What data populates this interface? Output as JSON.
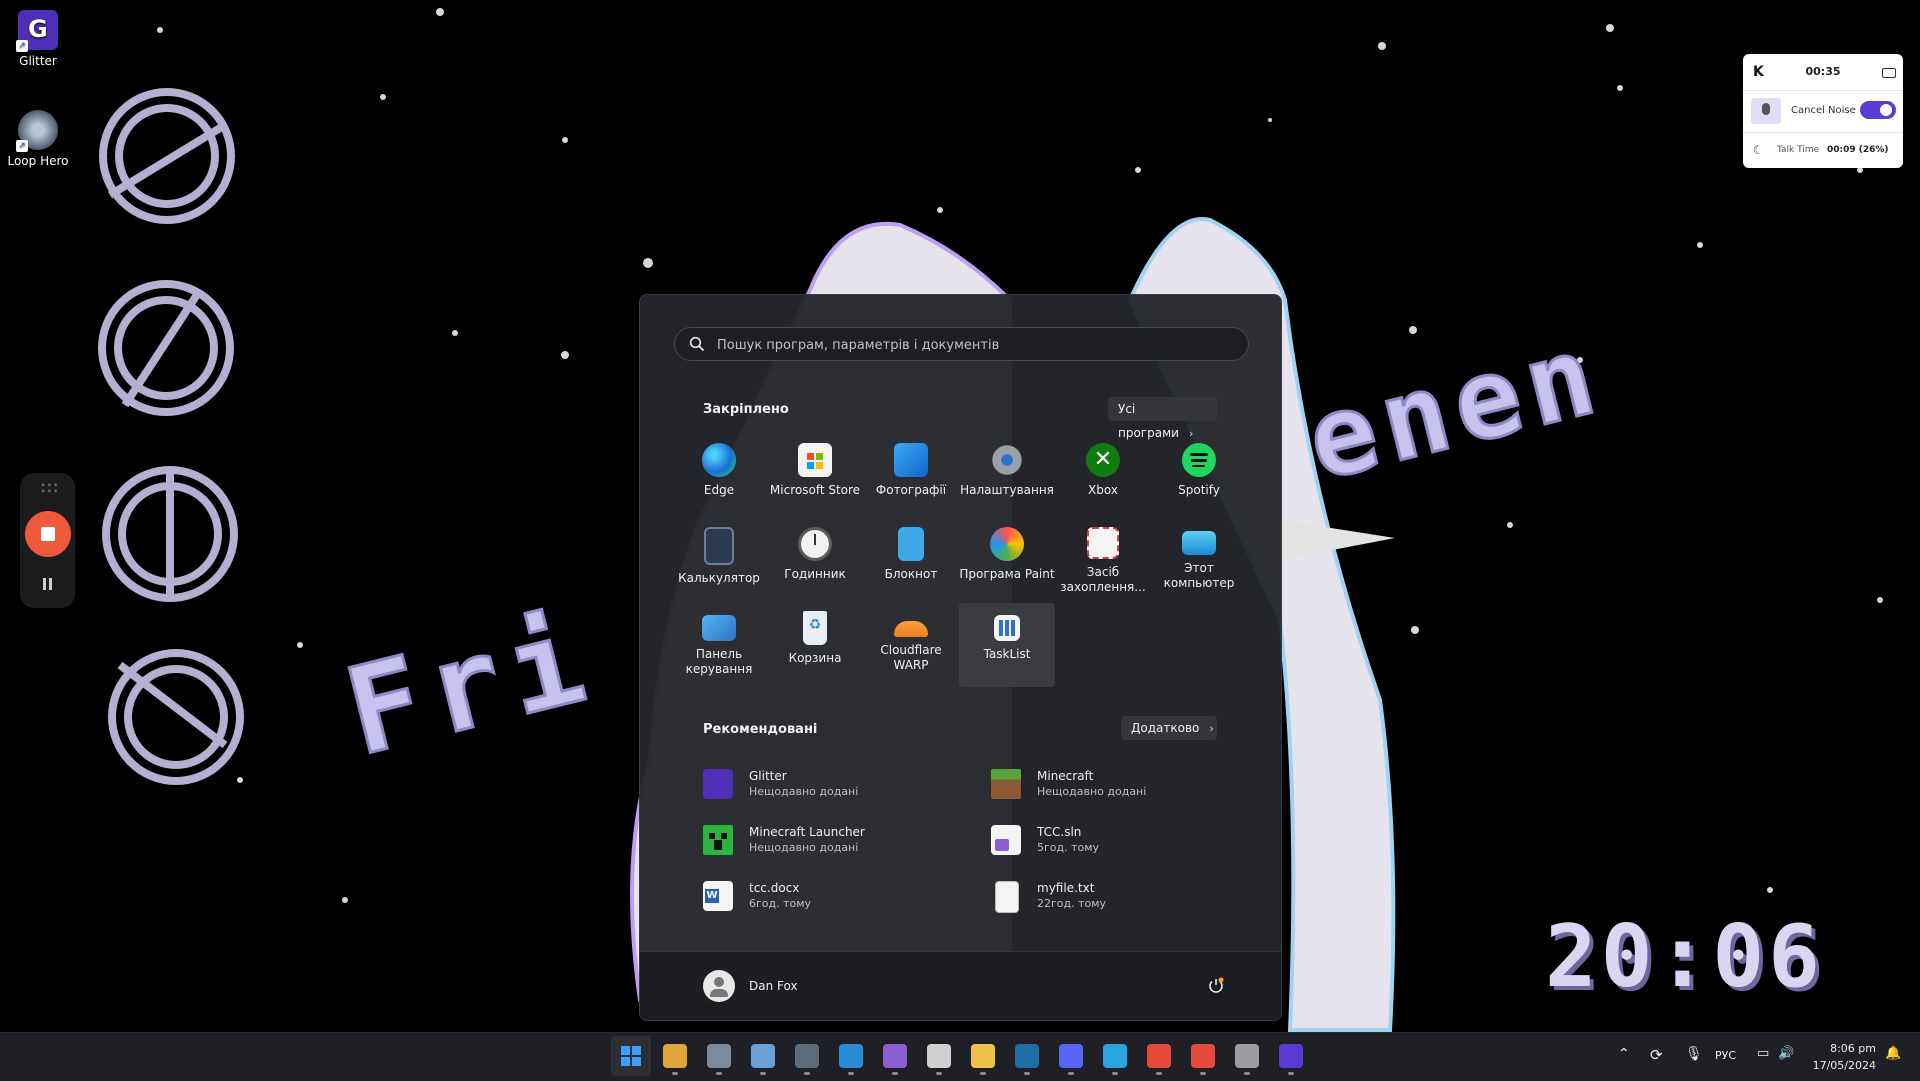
{
  "desktop": {
    "icons": [
      {
        "label": "Glitter",
        "icon": "glitter-app-icon"
      },
      {
        "label": "Loop Hero",
        "icon": "loop-hero-icon"
      }
    ],
    "wallpaper_text": "Fri... ...enen",
    "wallpaper_clock": "20:06"
  },
  "recorder": {
    "grip": "grip-icon",
    "stop": "stop-record-icon",
    "pause": "pause-icon"
  },
  "call_widget": {
    "timer": "00:35",
    "noise_label": "Cancel Noise",
    "noise_enabled": true,
    "talk_label": "Talk Time",
    "talk_value": "00:09 (26%)",
    "accent": "#5b3bd6"
  },
  "start_menu": {
    "search_placeholder": "Пошук програм, параметрів і документів",
    "pinned_title": "Закріплено",
    "all_apps_label": "Усі програми",
    "pinned": [
      {
        "label": "Edge",
        "icon": "edge-icon"
      },
      {
        "label": "Microsoft Store",
        "icon": "store-icon"
      },
      {
        "label": "Фотографії",
        "icon": "photos-icon"
      },
      {
        "label": "Налаштування",
        "icon": "settings-icon"
      },
      {
        "label": "Xbox",
        "icon": "xbox-icon"
      },
      {
        "label": "Spotify",
        "icon": "spotify-icon"
      },
      {
        "label": "Калькулятор",
        "icon": "calculator-icon"
      },
      {
        "label": "Годинник",
        "icon": "clock-icon"
      },
      {
        "label": "Блокнот",
        "icon": "notepad-icon"
      },
      {
        "label": "Програма Paint",
        "icon": "paint-icon"
      },
      {
        "label": "Засіб захоплення...",
        "icon": "snipping-tool-icon"
      },
      {
        "label": "Этот компьютер",
        "icon": "this-pc-icon"
      },
      {
        "label": "Панель керування",
        "icon": "control-panel-icon"
      },
      {
        "label": "Корзина",
        "icon": "recycle-bin-icon"
      },
      {
        "label": "Cloudflare WARP",
        "icon": "cloudflare-icon"
      },
      {
        "label": "TaskList",
        "icon": "tasklist-icon"
      }
    ],
    "recommended_title": "Рекомендовані",
    "more_label": "Додатково",
    "recommended": [
      {
        "name": "Glitter",
        "sub": "Нещодавно додані",
        "icon": "glitter-app-icon"
      },
      {
        "name": "Minecraft",
        "sub": "Нещодавно додані",
        "icon": "minecraft-icon"
      },
      {
        "name": "Minecraft Launcher",
        "sub": "Нещодавно додані",
        "icon": "minecraft-launcher-icon"
      },
      {
        "name": "TCC.sln",
        "sub": "5год. тому",
        "icon": "visual-studio-solution-icon"
      },
      {
        "name": "tcc.docx",
        "sub": "6год. тому",
        "icon": "word-document-icon"
      },
      {
        "name": "myfile.txt",
        "sub": "22год. тому",
        "icon": "text-file-icon"
      }
    ],
    "user_name": "Dan Fox"
  },
  "taskbar": {
    "apps": [
      {
        "name": "start",
        "icon": "windows-start-icon",
        "color": "#3aa0ff"
      },
      {
        "name": "copilot",
        "icon": "copilot-pre-icon",
        "color": "#e0a63b"
      },
      {
        "name": "loop-hero",
        "icon": "loop-hero-icon",
        "color": "#7d8a9a"
      },
      {
        "name": "paint-net",
        "icon": "image-editor-icon",
        "color": "#6aa0d8"
      },
      {
        "name": "calculator",
        "icon": "calculator-icon",
        "color": "#5d6b7a"
      },
      {
        "name": "vscode",
        "icon": "vscode-icon",
        "color": "#2a8bd8"
      },
      {
        "name": "visual-studio",
        "icon": "visual-studio-icon",
        "color": "#8a5fd0"
      },
      {
        "name": "unity",
        "icon": "unity-icon",
        "color": "#cfcfcf"
      },
      {
        "name": "explorer",
        "icon": "folder-icon",
        "color": "#f1c24a"
      },
      {
        "name": "steam",
        "icon": "steam-icon",
        "color": "#1b6ea8"
      },
      {
        "name": "discord",
        "icon": "discord-icon",
        "color": "#5865f2"
      },
      {
        "name": "telegram",
        "icon": "telegram-icon",
        "color": "#2aa3e0"
      },
      {
        "name": "chrome",
        "icon": "chrome-icon",
        "color": "#e64a3c"
      },
      {
        "name": "chrome-profile",
        "icon": "chrome-icon",
        "color": "#e64a3c"
      },
      {
        "name": "settings",
        "icon": "settings-icon",
        "color": "#9a9ca0"
      },
      {
        "name": "glitter",
        "icon": "glitter-app-icon",
        "color": "#5b3bd6"
      }
    ],
    "tray": {
      "language": "РУС",
      "time": "8:06 pm",
      "date": "17/05/2024"
    }
  }
}
